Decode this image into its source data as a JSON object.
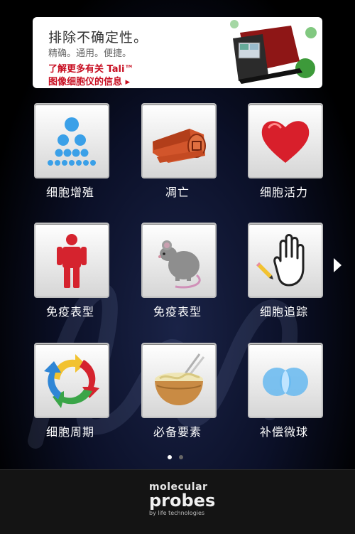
{
  "banner": {
    "title": "排除不确定性。",
    "subtitle": "精确。通用。便捷。",
    "link_line1": "了解更多有关 Tali™",
    "link_line2": "图像细胞仪的信息 ▸"
  },
  "tiles": [
    {
      "label": "细胞增殖",
      "icon": "cell-proliferation-icon"
    },
    {
      "label": "凋亡",
      "icon": "apoptosis-icon"
    },
    {
      "label": "细胞活力",
      "icon": "heart-icon"
    },
    {
      "label": "免疫表型",
      "icon": "human-figure-icon"
    },
    {
      "label": "免疫表型",
      "icon": "mouse-icon"
    },
    {
      "label": "细胞追踪",
      "icon": "hand-tracking-icon"
    },
    {
      "label": "细胞周期",
      "icon": "cycle-arrows-icon"
    },
    {
      "label": "必备要素",
      "icon": "noodle-bowl-icon"
    },
    {
      "label": "补偿微球",
      "icon": "overlapping-circles-icon"
    }
  ],
  "pagination": {
    "pages": 2,
    "current": 1
  },
  "footer": {
    "logo_line1": "molecular",
    "logo_line2": "probes",
    "logo_line3": "by life technologies"
  },
  "colors": {
    "brand_red": "#c80f22",
    "icon_blue": "#3aa0e8",
    "active_dot": "#ffffff",
    "inactive_dot": "#666666"
  }
}
